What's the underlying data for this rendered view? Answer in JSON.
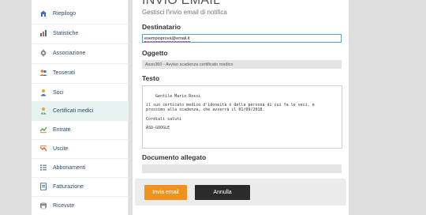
{
  "sidebar": {
    "items": [
      {
        "label": "Riepilogo",
        "icon": "house-icon"
      },
      {
        "label": "Statistiche",
        "icon": "chart-icon"
      },
      {
        "label": "Associazione",
        "icon": "settings-icon"
      },
      {
        "label": "Tesserati",
        "icon": "users-icon"
      },
      {
        "label": "Soci",
        "icon": "person-icon"
      },
      {
        "label": "Certificati medici",
        "icon": "doctor-icon"
      },
      {
        "label": "Entrate",
        "icon": "income-icon"
      },
      {
        "label": "Uscite",
        "icon": "expense-icon"
      },
      {
        "label": "Abbonamenti",
        "icon": "list-icon"
      },
      {
        "label": "Fatturazione",
        "icon": "invoice-icon"
      },
      {
        "label": "Ricevute",
        "icon": "receipt-icon"
      }
    ],
    "active_index": 5
  },
  "main": {
    "title": "INVIO EMAIL",
    "subtitle": "Gestisci l'invio email di notifica",
    "recipient": {
      "label": "Destinatario",
      "value": "esempioprova@email.it"
    },
    "subject": {
      "label": "Oggetto",
      "value": "Asso360 - Avviso scadenza certificato medico"
    },
    "body": {
      "label": "Testo",
      "value": "Gentile Mario Rossi\n\nil suo certicato medico d'idoneità o della persona di cui fa le veci, è\nprossimo alla scadenza, che avverrà il 01/09/2018.\n\nCordiali saluti\n\nASD-GOOGLE"
    },
    "attachment": {
      "label": "Documento allegato",
      "value": ""
    },
    "buttons": {
      "send": "Invia email",
      "cancel": "Annulla"
    }
  },
  "colors": {
    "accent_orange": "#f0931e",
    "cancel_dark": "#2b2b2b",
    "active_bg": "#e6f3f1",
    "focus_border": "#5b9bd5"
  }
}
